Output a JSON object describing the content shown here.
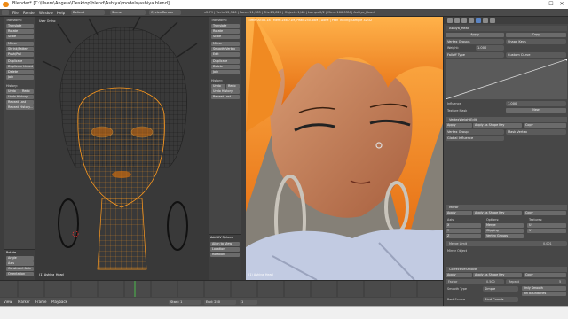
{
  "window": {
    "title": "Blender* [C:\\Users\\Angela\\Desktop\\blend\\Ashiya\\models\\ashiya.blend]",
    "minimize": "–",
    "maximize": "☐",
    "close": "✕"
  },
  "menubar": {
    "items": [
      "File",
      "Render",
      "Window",
      "Help"
    ],
    "layout": "Default",
    "scene": "Scene",
    "engine": "Cycles Render",
    "stats": "v2.79 | Verts:12,546 | Faces:11,985 | Tris:23,820 | Objects:1/48 | Lamps:0/2 | Mem:166.03M | Ashiya_Head"
  },
  "left_toolbar": {
    "tabs": [
      "Tools",
      "Create",
      "Relations",
      "Display",
      "Shading",
      "Options",
      "Grease Pencil"
    ],
    "header_transform": "Transform:",
    "items": [
      "Translate",
      "Rotate",
      "Scale",
      "Mirror",
      "Shrink/Fatten",
      "Push/Pull",
      "Duplicate",
      "Duplicate Linked",
      "Delete",
      "Join"
    ],
    "header_history": "History:",
    "history": [
      "Undo",
      "Redo",
      "Undo History",
      "Repeat Last",
      "Repeat History..."
    ],
    "operator_title": "Rotate",
    "operator_fields": [
      "Angle",
      "Axis",
      "Constraint Axis",
      "Orientation",
      "Proportional Editing"
    ]
  },
  "left_viewport": {
    "title": "User Ortho",
    "object_label": "(1) Ashiya_Head",
    "mode": "Object Mode",
    "global": "Global"
  },
  "mid_toolbar": {
    "header_transform": "Transform:",
    "items": [
      "Translate",
      "Rotate",
      "Scale",
      "Mirror",
      "Smooth Vertex",
      "Edit",
      "Duplicate",
      "Delete",
      "Join"
    ],
    "header_history": "History:",
    "history": [
      "Undo",
      "Redo",
      "Undo History",
      "Repeat Last"
    ],
    "operator_title": "Add UV Sphere",
    "checkboxes": [
      "Align to View",
      "Location",
      "Rotation"
    ]
  },
  "right_viewport": {
    "info": "Time:00:05.18 | Mem:246.71M, Peak:250.88M | Done | Path Tracing Sample 32/32",
    "object_label": "(1) Ashiya_Head",
    "mode": "Object Mode",
    "shading": "Rendered"
  },
  "properties": {
    "tabs": [
      "Scene",
      "Render",
      "World",
      "Object",
      "Modifiers",
      "Data",
      "Material"
    ],
    "object_name": "Ashiya_Head",
    "section_transform": "Transform",
    "loc_rot_btns": [
      "Apply",
      "Copy"
    ],
    "vertex_groups": "Vertex Groups",
    "weight_label": "Weight:",
    "weight_value": "1.000",
    "shape_keys": "Shape Keys",
    "falloff": "Falloff Type",
    "falloff_value": "Custom Curve",
    "influence_label": "Influence",
    "influence_value": "1.000",
    "texture_label": "Texture Mask",
    "new_button": "New",
    "mod1_name": "VertexWeightEdit",
    "apply": "Apply",
    "apply_shape": "Apply as Shape Key",
    "copy": "Copy",
    "mod1_fields": [
      "Vertex Group",
      "Mask Vertex",
      "Global Influence"
    ],
    "mod2_name": "Mirror",
    "axis": "Axis:",
    "options": "Options:",
    "textures": "Textures:",
    "axes": [
      "X",
      "Y",
      "Z"
    ],
    "mirror_opts": [
      "Merge",
      "Clipping",
      "Vertex Groups"
    ],
    "tex_opts": [
      "U",
      "V"
    ],
    "merge_limit": "Merge Limit",
    "merge_value": "0.001",
    "mirror_object": "Mirror Object",
    "mod3_name": "CorrectiveSmooth",
    "factor_label": "Factor",
    "factor_value": "0.500",
    "repeat_label": "Repeat",
    "repeat_value": "5",
    "smooth_type": "Smooth Type",
    "smooth_value": "Simple",
    "only_smooth": "Only Smooth",
    "pin_boundaries": "Pin Boundaries",
    "rest_source": "Rest Source",
    "rest_value": "Bind Coords",
    "bind": "Bind",
    "footer_label": "Subdivision"
  },
  "timeline": {
    "menus": [
      "View",
      "Marker",
      "Frame",
      "Playback"
    ],
    "start_label": "Start:",
    "start": "1",
    "end_label": "End:",
    "end": "250",
    "current": "1",
    "ticks": [
      "-40",
      "-20",
      "0",
      "20",
      "40",
      "60",
      "80",
      "100",
      "120",
      "140",
      "160",
      "180",
      "200",
      "220",
      "240",
      "260"
    ]
  },
  "colors": {
    "accent": "#ef8a14",
    "wire": "#ff9a1e",
    "bg": "#393939",
    "panel": "#474747"
  }
}
